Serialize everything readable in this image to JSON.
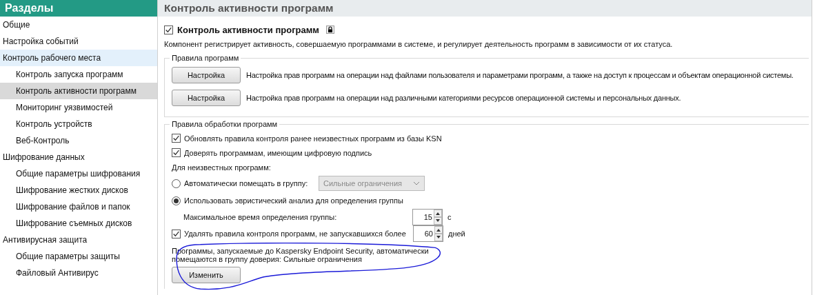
{
  "sidebar": {
    "title": "Разделы",
    "items": [
      {
        "label": "Общие",
        "selected": false,
        "hovered": false
      },
      {
        "label": "Настройка событий",
        "selected": false,
        "hovered": false
      },
      {
        "label": "Контроль рабочего места",
        "selected": false,
        "hovered": true,
        "children": [
          {
            "label": "Контроль запуска программ",
            "selected": false,
            "hovered": false
          },
          {
            "label": "Контроль активности программ",
            "selected": true,
            "hovered": false
          },
          {
            "label": "Мониторинг уязвимостей",
            "selected": false,
            "hovered": false
          },
          {
            "label": "Контроль устройств",
            "selected": false,
            "hovered": false
          },
          {
            "label": "Веб-Контроль",
            "selected": false,
            "hovered": false
          }
        ]
      },
      {
        "label": "Шифрование данных",
        "selected": false,
        "hovered": false,
        "children": [
          {
            "label": "Общие параметры шифрования",
            "selected": false,
            "hovered": false
          },
          {
            "label": "Шифрование жестких дисков",
            "selected": false,
            "hovered": false
          },
          {
            "label": "Шифрование файлов и папок",
            "selected": false,
            "hovered": false
          },
          {
            "label": "Шифрование съемных дисков",
            "selected": false,
            "hovered": false
          }
        ]
      },
      {
        "label": "Антивирусная защита",
        "selected": false,
        "hovered": false,
        "children": [
          {
            "label": "Общие параметры защиты",
            "selected": false,
            "hovered": false
          },
          {
            "label": "Файловый Антивирус",
            "selected": false,
            "hovered": false
          }
        ]
      }
    ]
  },
  "main": {
    "title": "Контроль активности программ",
    "component": {
      "label": "Контроль активности программ",
      "checked": true,
      "locked": true
    },
    "description": "Компонент регистрирует активность, совершаемую программами в системе, и регулирует деятельность программ в зависимости от их статуса.",
    "rules_group": {
      "title": "Правила программ",
      "rows": [
        {
          "button": "Настройка",
          "text": "Настройка прав программ на операции над файлами пользователя и параметрами программ, а также на доступ к процессам и объектам операционной системы."
        },
        {
          "button": "Настройка",
          "text": "Настройка прав программ на операции над различными категориями ресурсов операционной системы и персональных данных."
        }
      ]
    },
    "processing_group": {
      "title": "Правила обработки программ",
      "update_ksn": {
        "label": "Обновлять правила контроля ранее неизвестных программ из базы KSN",
        "checked": true
      },
      "trust_signed": {
        "label": "Доверять программам, имеющим цифровую подпись",
        "checked": true
      },
      "unknown_label": "Для неизвестных программ:",
      "radio_auto": {
        "label": "Автоматически помещать в группу:",
        "selected": false,
        "dropdown": {
          "value": "Сильные ограничения",
          "disabled": true
        }
      },
      "radio_heuristic": {
        "label": "Использовать эвристический анализ для определения группы",
        "selected": true
      },
      "max_time": {
        "label": "Максимальное время определения группы:",
        "value": "15",
        "unit": "с"
      },
      "delete_rules": {
        "label": "Удалять правила контроля программ, не запускавшихся более",
        "checked": true,
        "value": "60",
        "unit": "дней"
      },
      "trusted_text": "Программы, запускаемые до Kaspersky Endpoint Security, автоматически помещаются в группу доверия: Сильные ограничения",
      "change_button": "Изменить"
    }
  }
}
